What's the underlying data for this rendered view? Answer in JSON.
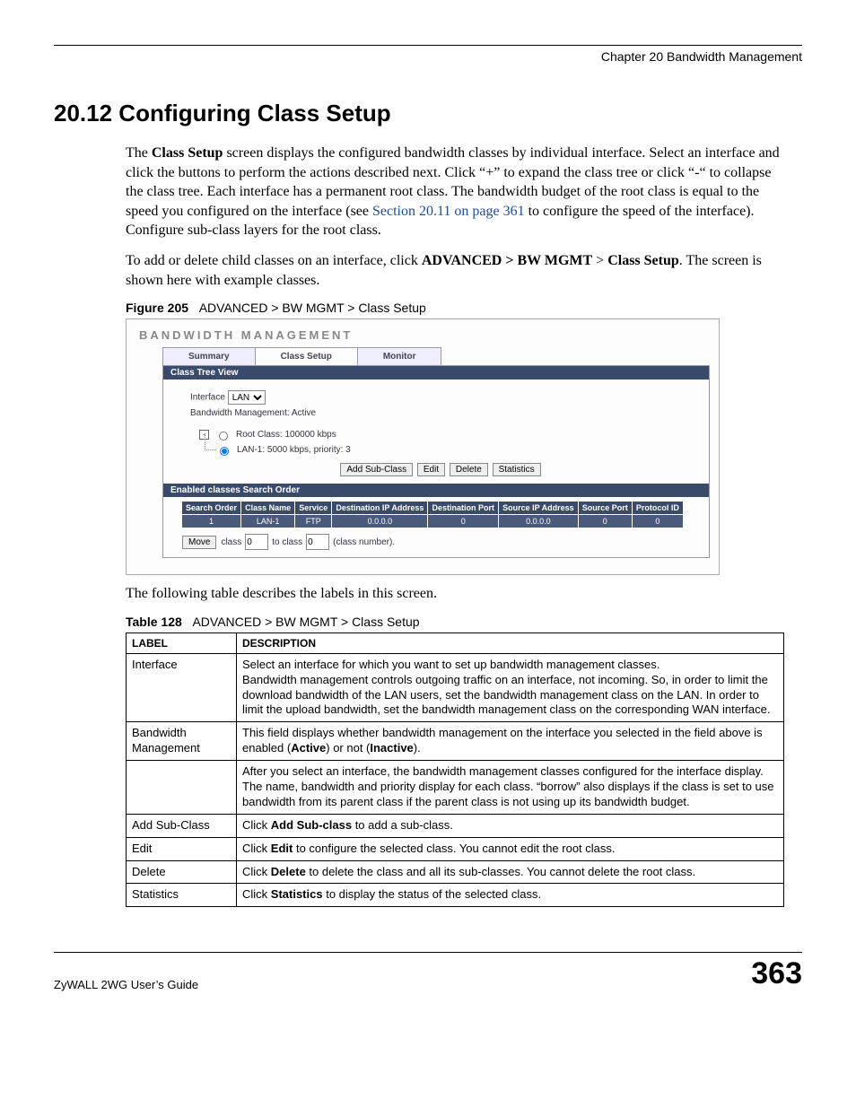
{
  "chapter_header": "Chapter 20 Bandwidth Management",
  "section_title": "20.12  Configuring Class Setup",
  "para1_a": "The ",
  "para1_b": "Class Setup",
  "para1_c": " screen displays the configured bandwidth classes by individual interface. Select an interface and click the buttons to perform the actions described next. Click “+” to expand the class tree or click “-“ to collapse the class tree. Each interface has a permanent root class. The bandwidth budget of the root class is equal to the speed you configured on the interface (see ",
  "para1_link": "Section 20.11 on page 361",
  "para1_d": " to configure the speed of the interface). Configure sub-class layers for the root class.",
  "para2_a": "To add or delete child classes on an interface, click ",
  "para2_b": "ADVANCED > BW MGMT",
  "para2_c": " > ",
  "para2_d": "Class Setup",
  "para2_e": ". The screen is shown here with example classes.",
  "fig_label": "Figure 205",
  "fig_caption": "ADVANCED > BW MGMT > Class Setup",
  "shot": {
    "title": "BANDWIDTH MANAGEMENT",
    "tabs": [
      "Summary",
      "Class Setup",
      "Monitor"
    ],
    "active_tab": 1,
    "bar1": "Class Tree View",
    "iface_label": "Interface",
    "iface_value": "LAN",
    "bm_status": "Bandwidth Management: Active",
    "root_label": "Root Class: 100000 kbps",
    "child_label": "LAN-1: 5000 kbps, priority: 3",
    "buttons": [
      "Add Sub-Class",
      "Edit",
      "Delete",
      "Statistics"
    ],
    "bar2": "Enabled classes Search Order",
    "headers": [
      "Search Order",
      "Class Name",
      "Service",
      "Destination IP Address",
      "Destination Port",
      "Source IP Address",
      "Source Port",
      "Protocol ID"
    ],
    "row": [
      "1",
      "LAN-1",
      "FTP",
      "0.0.0.0",
      "0",
      "0.0.0.0",
      "0",
      "0"
    ],
    "move_btn": "Move",
    "move_text1": "class",
    "move_val1": "0",
    "move_text2": "to class",
    "move_val2": "0",
    "move_text3": "(class number)."
  },
  "post_fig": "The following table describes the labels in this screen.",
  "tab_label": "Table 128",
  "tab_caption": "ADVANCED > BW MGMT > Class Setup",
  "desc": {
    "head_label": "LABEL",
    "head_desc": "DESCRIPTION",
    "rows": [
      {
        "label": "Interface",
        "desc_a": "Select an interface for which you want to set up bandwidth management classes.",
        "desc_b": "Bandwidth management controls outgoing traffic on an interface, not incoming. So, in order to limit the download bandwidth of the LAN users, set the bandwidth management class on the LAN. In order to limit the upload bandwidth, set the bandwidth management class on the corresponding WAN interface."
      },
      {
        "label": "Bandwidth Management",
        "desc_a": "This field displays whether bandwidth management on the interface you selected in the field above is enabled (",
        "desc_bold1": "Active",
        "desc_mid": ") or not (",
        "desc_bold2": "Inactive",
        "desc_end": ")."
      },
      {
        "label": "",
        "desc_a": "After you select an interface, the bandwidth management classes configured for the interface display. The name, bandwidth and priority display for each class. “borrow” also displays if the class is set to use bandwidth from its parent class if the parent class is not using up its bandwidth budget."
      },
      {
        "label": "Add Sub-Class",
        "desc_pre": "Click ",
        "desc_bold": "Add Sub-class",
        "desc_post": " to add a sub-class."
      },
      {
        "label": "Edit",
        "desc_pre": "Click ",
        "desc_bold": "Edit",
        "desc_post": " to configure the selected class. You cannot edit the root class."
      },
      {
        "label": "Delete",
        "desc_pre": "Click ",
        "desc_bold": "Delete",
        "desc_post": " to delete the class and all its sub-classes. You cannot delete the root class."
      },
      {
        "label": "Statistics",
        "desc_pre": "Click ",
        "desc_bold": "Statistics",
        "desc_post": " to display the status of the selected class."
      }
    ]
  },
  "footer_left": "ZyWALL 2WG User’s Guide",
  "footer_right": "363"
}
